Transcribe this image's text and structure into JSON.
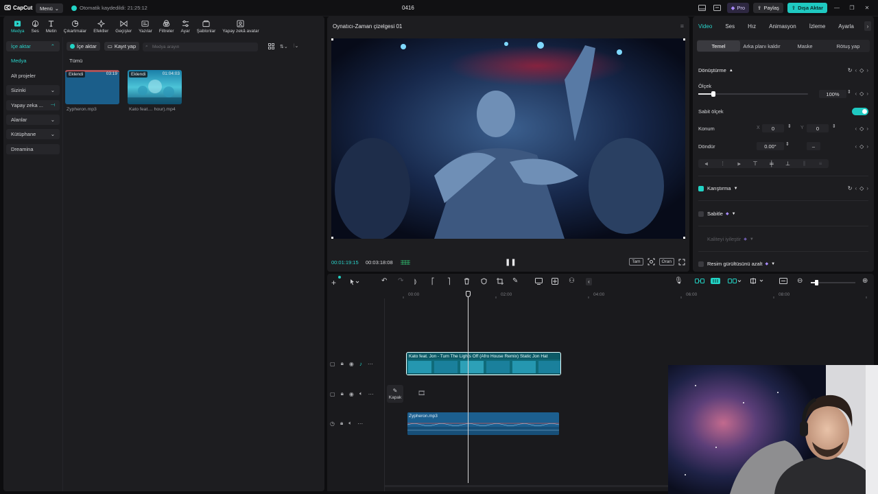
{
  "app": {
    "logo_text": "CapCut",
    "menu_label": "Menü",
    "autosave_text": "Otomatik kaydedildi: 21:25:12",
    "project_title": "0416",
    "pro_label": "Pro",
    "share_label": "Paylaş",
    "export_label": "Dışa Aktar"
  },
  "toolbar": {
    "tabs": [
      {
        "label": "Medya",
        "icon": "media-icon"
      },
      {
        "label": "Ses",
        "icon": "audio-icon"
      },
      {
        "label": "Metin",
        "icon": "text-icon"
      },
      {
        "label": "Çıkartmalar",
        "icon": "sticker-icon"
      },
      {
        "label": "Efektler",
        "icon": "effects-icon"
      },
      {
        "label": "Geçişler",
        "icon": "transitions-icon"
      },
      {
        "label": "Yazılar",
        "icon": "captions-icon"
      },
      {
        "label": "Filtreler",
        "icon": "filters-icon"
      },
      {
        "label": "Ayar",
        "icon": "adjust-icon"
      },
      {
        "label": "Şablonlar",
        "icon": "templates-icon"
      },
      {
        "label": "Yapay zekâ avatar",
        "icon": "ai-avatar-icon"
      }
    ]
  },
  "sidebar": {
    "items": [
      {
        "label": "İçe aktar"
      },
      {
        "label": "Medya"
      },
      {
        "label": "Alt projeler"
      },
      {
        "label": "Sizinki"
      },
      {
        "label": "Yapay zeka ..."
      },
      {
        "label": "Alanlar"
      },
      {
        "label": "Kütüphane"
      },
      {
        "label": "Dreamina"
      }
    ]
  },
  "media": {
    "import_label": "İçe aktar",
    "record_label": "Kayıt yap",
    "search_placeholder": "Medya arayın",
    "filter_label": "Tümü",
    "items": [
      {
        "badge": "Eklendi",
        "duration": "03:19",
        "name": "Zypheron.mp3"
      },
      {
        "badge": "Eklendi",
        "duration": "01:04:03",
        "name": "Kato feat.... hour).mp4"
      }
    ]
  },
  "player": {
    "title": "Oynatıcı-Zaman çizelgesi 01",
    "current_time": "00:01:19:15",
    "total_time": "00:03:18:08",
    "full_label": "Tam",
    "ratio_label": "Oran"
  },
  "properties": {
    "tabs": [
      "Video",
      "Ses",
      "Hız",
      "Animasyon",
      "İzleme",
      "Ayarla"
    ],
    "subtabs": [
      "Temel",
      "Arka planı kaldır",
      "Maske",
      "Rötuş yap"
    ],
    "transform_label": "Dönüştürme",
    "scale_label": "Ölçek",
    "scale_value": "100%",
    "scale_fraction": 0.14,
    "uniform_scale_label": "Sabit ölçek",
    "position_label": "Konum",
    "x_label": "X",
    "x_value": "0",
    "y_label": "Y",
    "y_value": "0",
    "rotate_label": "Döndür",
    "rotate_value": "0.00°",
    "blend_label": "Karıştırma",
    "stabilize_label": "Sabitle",
    "enhance_label": "Kaliteyi iyileştir",
    "denoise_label": "Resim gürültüsünü azalt"
  },
  "timeline": {
    "ruler_labels": [
      "00:00",
      "02:00",
      "04:00",
      "06:00",
      "08:00"
    ],
    "video_clip_name": "Kato feat. Jon - Turn The Lights Off (Afro House Remix) Static Jon Hat",
    "audio_clip_name": "Zypheron.mp3",
    "cover_label": "Kapak"
  },
  "colors": {
    "accent": "#22d3c5",
    "video_clip": "#0d5a66",
    "audio_clip": "#1c5f8f"
  }
}
